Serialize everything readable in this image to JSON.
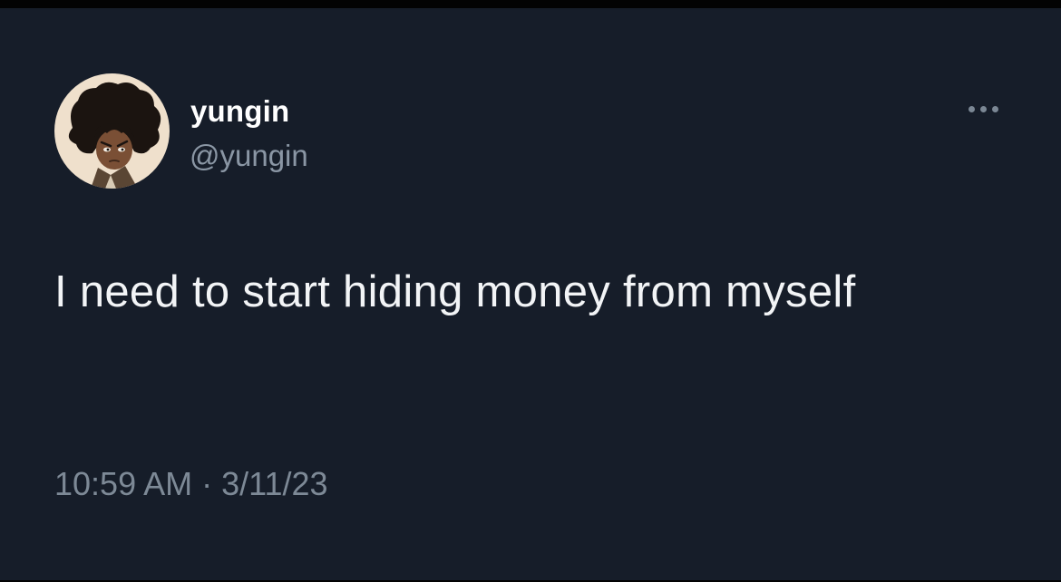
{
  "tweet": {
    "author": {
      "display_name": "yungin",
      "handle": "@yungin",
      "avatar_icon": "cartoon-character-avatar"
    },
    "text": "I need to start hiding money from myself",
    "time": "10:59 AM",
    "separator": "·",
    "date": "3/11/23",
    "more_icon": "more-horizontal-icon"
  },
  "colors": {
    "background": "#161d29",
    "text": "#f2f4f6",
    "secondary_text": "#8a96a4",
    "avatar_bg": "#efe0cc"
  }
}
